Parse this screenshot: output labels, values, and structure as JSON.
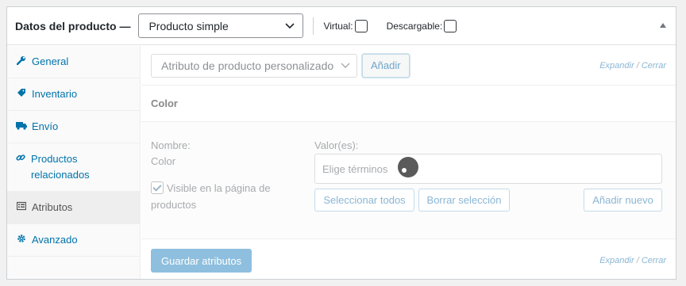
{
  "header": {
    "title": "Datos del producto —",
    "product_type": "Producto simple",
    "virtual_label": "Virtual:",
    "downloadable_label": "Descargable:"
  },
  "tabs": [
    {
      "label": "General",
      "icon": "wrench-icon"
    },
    {
      "label": "Inventario",
      "icon": "tag-icon"
    },
    {
      "label": "Envío",
      "icon": "truck-icon"
    },
    {
      "label": "Productos relacionados",
      "icon": "link-icon"
    },
    {
      "label": "Atributos",
      "icon": "list-icon",
      "active": true
    },
    {
      "label": "Avanzado",
      "icon": "gear-icon"
    }
  ],
  "toolbar": {
    "attribute_select": "Atributo de producto personalizado",
    "add_button": "Añadir",
    "expand": "Expandir",
    "separator": "/",
    "close": "Cerrar"
  },
  "attribute": {
    "heading": "Color",
    "name_label": "Nombre:",
    "name_value": "Color",
    "visible_label": "Visible en la página de productos",
    "values_label": "Valor(es):",
    "terms_placeholder": "Elige términos",
    "select_all": "Seleccionar todos",
    "clear_selection": "Borrar selección",
    "add_new": "Añadir nuevo"
  },
  "footer": {
    "save_button": "Guardar atributos",
    "expand": "Expandir",
    "separator": "/",
    "close": "Cerrar"
  },
  "colors": {
    "link": "#0073aa",
    "border": "#ccd0d4",
    "primary_disabled": "#8ebfde"
  }
}
